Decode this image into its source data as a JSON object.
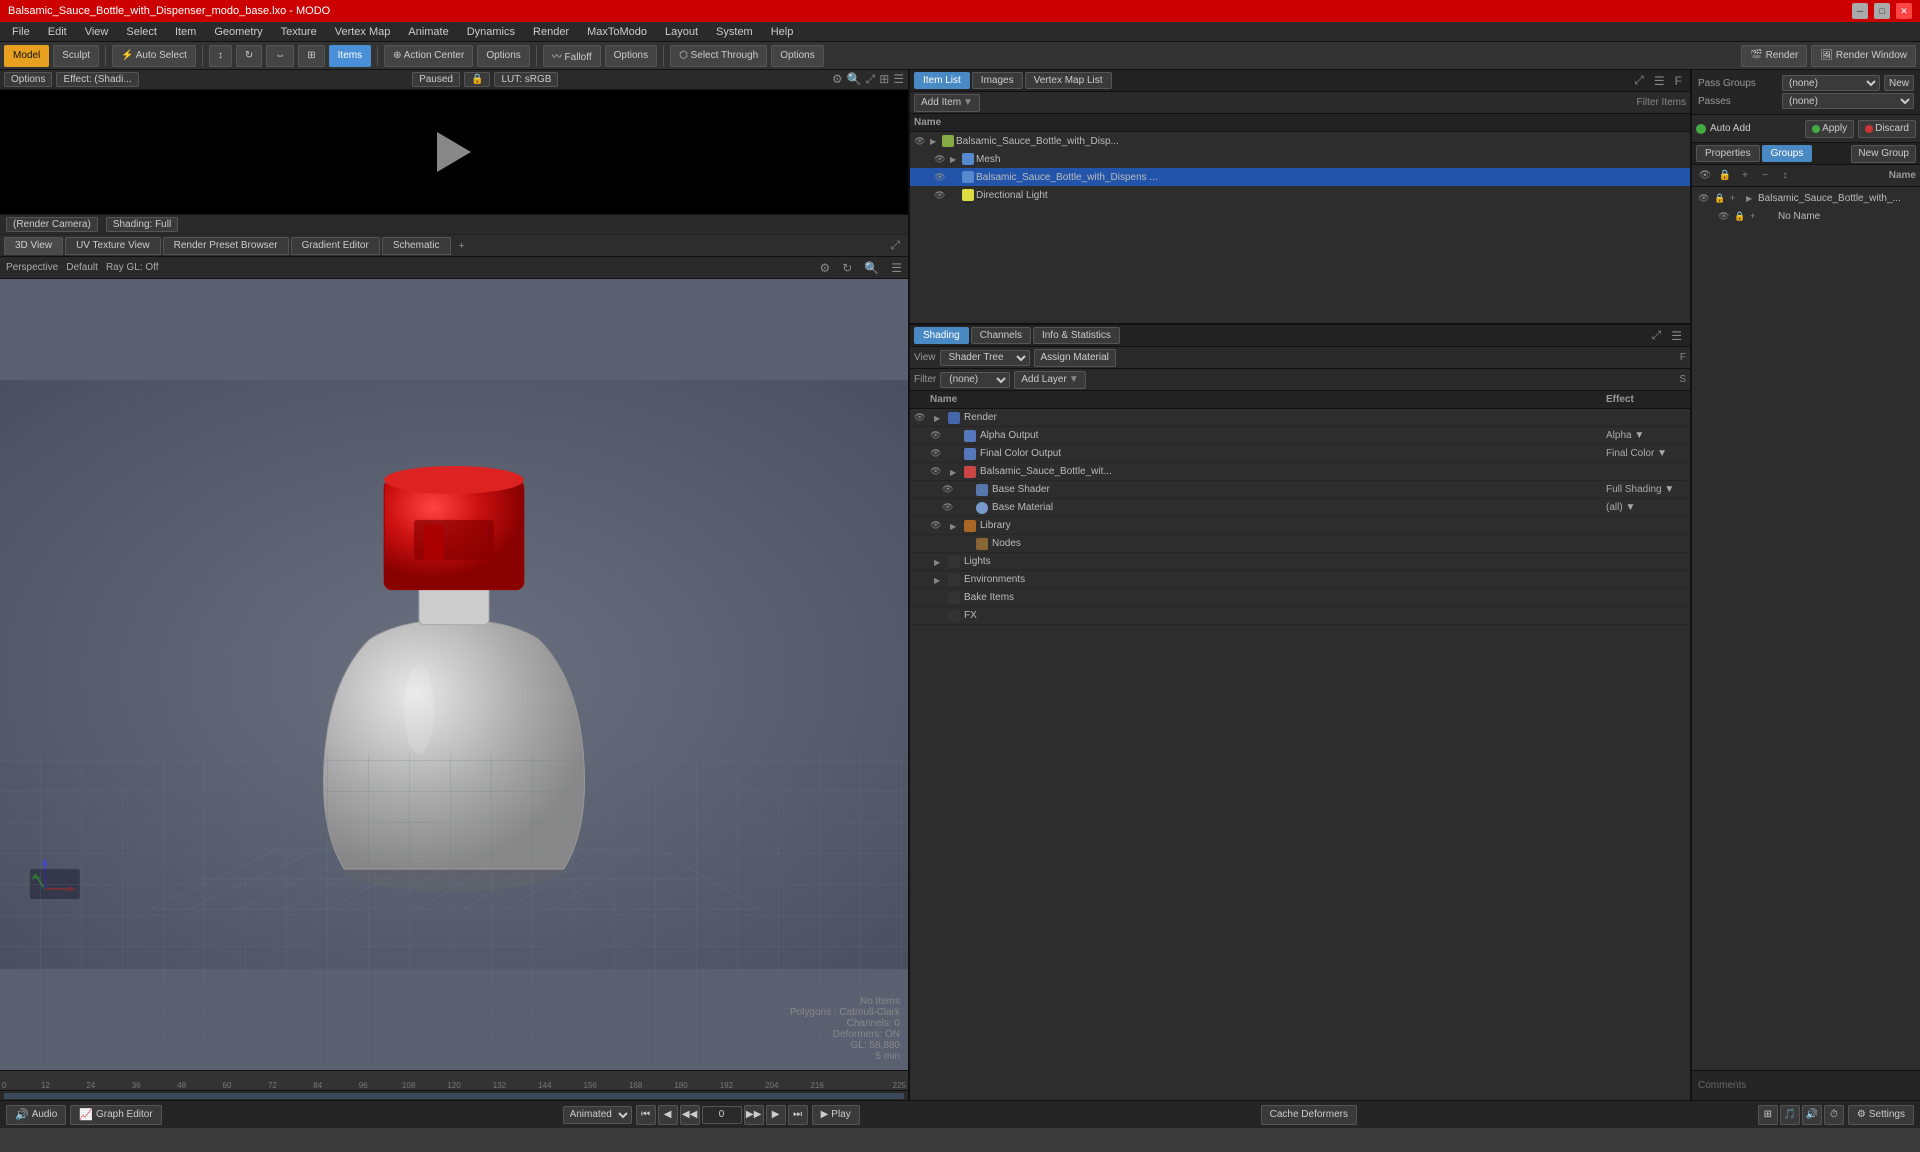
{
  "titlebar": {
    "title": "Balsamic_Sauce_Bottle_with_Dispenser_modo_base.lxo - MODO",
    "controls": [
      "─",
      "□",
      "✕"
    ]
  },
  "menubar": {
    "items": [
      "File",
      "Edit",
      "View",
      "Select",
      "Item",
      "Geometry",
      "Texture",
      "Vertex Map",
      "Animate",
      "Dynamics",
      "Render",
      "MaxToModo",
      "Layout",
      "System",
      "Help"
    ]
  },
  "toolbar": {
    "mode_btns": [
      "Model",
      "Sculpt"
    ],
    "auto_select": "Auto Select",
    "items_btn": "Items",
    "action_center": "Action Center",
    "options1": "Options",
    "falloff": "Falloff",
    "options2": "Options",
    "select_through": "Select Through",
    "options3": "Options",
    "render": "Render",
    "render_window": "Render Window"
  },
  "preview": {
    "effect": "Effect: (Shadi...",
    "paused": "Paused",
    "lut": "LUT: sRGB",
    "render_camera": "(Render Camera)",
    "shading": "Shading: Full"
  },
  "viewport": {
    "tabs": [
      "3D View",
      "UV Texture View",
      "Render Preset Browser",
      "Gradient Editor",
      "Schematic"
    ],
    "mode": "Perspective",
    "default": "Default",
    "ray_gl": "Ray GL: Off"
  },
  "item_list": {
    "panel_tabs": [
      "Item List",
      "Images",
      "Vertex Map List"
    ],
    "filter_label": "Filter Items",
    "add_item": "Add Item",
    "name_col": "Name",
    "items": [
      {
        "label": "Balsamic_Sauce_Bottle_with_Disp...",
        "level": 0,
        "type": "scene",
        "expanded": true
      },
      {
        "label": "Mesh",
        "level": 1,
        "type": "mesh",
        "expanded": false
      },
      {
        "label": "Balsamic_Sauce_Bottle_with_Dispens ...",
        "level": 1,
        "type": "mesh",
        "expanded": false
      },
      {
        "label": "Directional Light",
        "level": 1,
        "type": "light",
        "expanded": false
      }
    ]
  },
  "shader_tree": {
    "panel_tabs": [
      "Shading",
      "Channels",
      "Info & Statistics"
    ],
    "view": "Shader Tree",
    "assign_material": "Assign Material",
    "filter_label": "(none)",
    "add_layer": "Add Layer",
    "name_col": "Name",
    "effect_col": "Effect",
    "items": [
      {
        "label": "Render",
        "level": 0,
        "type": "render",
        "effect": "",
        "has_arrow": true
      },
      {
        "label": "Alpha Output",
        "level": 1,
        "type": "output",
        "effect": "Alpha",
        "has_dropdown": true
      },
      {
        "label": "Final Color Output",
        "level": 1,
        "type": "output",
        "effect": "Final Color",
        "has_dropdown": true
      },
      {
        "label": "Balsamic_Sauce_Bottle_wit...",
        "level": 1,
        "type": "material",
        "effect": "",
        "has_arrow": true
      },
      {
        "label": "Base Shader",
        "level": 2,
        "type": "shader",
        "effect": "Full Shading",
        "has_dropdown": true
      },
      {
        "label": "Base Material",
        "level": 2,
        "type": "material",
        "effect": "(all)",
        "has_dropdown": true
      },
      {
        "label": "Library",
        "level": 1,
        "type": "library",
        "effect": "",
        "has_arrow": true
      },
      {
        "label": "Nodes",
        "level": 2,
        "type": "nodes",
        "effect": ""
      },
      {
        "label": "Lights",
        "level": 0,
        "type": "lights",
        "effect": "",
        "has_arrow": true
      },
      {
        "label": "Environments",
        "level": 0,
        "type": "environments",
        "effect": "",
        "has_arrow": true
      },
      {
        "label": "Bake Items",
        "level": 0,
        "type": "bake",
        "effect": ""
      },
      {
        "label": "FX",
        "level": 0,
        "type": "fx",
        "effect": ""
      }
    ]
  },
  "groups": {
    "tabs": [
      "Properties",
      "Groups"
    ],
    "new_group": "New Group",
    "name_col": "Name",
    "toolbar_icons": [
      "eye",
      "lock",
      "plus",
      "minus",
      "arrow"
    ],
    "items": [
      {
        "label": "Balsamic_Sauce_Bottle_with_...",
        "level": 0
      },
      {
        "label": "No Name",
        "level": 1
      }
    ]
  },
  "pass_groups": {
    "label": "Pass Groups:",
    "value": "(none)",
    "passes_label": "Passes:",
    "passes_value": "(none)",
    "new_btn": "New"
  },
  "auto_add": {
    "label": "Auto Add",
    "apply": "Apply",
    "discard": "Discard"
  },
  "viewport_info": {
    "no_items": "No Items",
    "polygons": "Polygons : Catmull-Clark",
    "channels": "Channels: 0",
    "deformers": "Deformers: ON",
    "gl": "GL: 58,880",
    "time": "5 min"
  },
  "timeline": {
    "start": "0",
    "end": "225",
    "frame": "0",
    "marks": [
      "0",
      "12",
      "24",
      "36",
      "48",
      "60",
      "72",
      "84",
      "96",
      "108",
      "120",
      "132",
      "144",
      "156",
      "168",
      "180",
      "192",
      "204",
      "216"
    ]
  },
  "bottombar": {
    "audio": "Audio",
    "graph_editor": "Graph Editor",
    "animated": "Animated",
    "play": "Play",
    "cache_deformers": "Cache Deformers",
    "settings": "Settings"
  }
}
